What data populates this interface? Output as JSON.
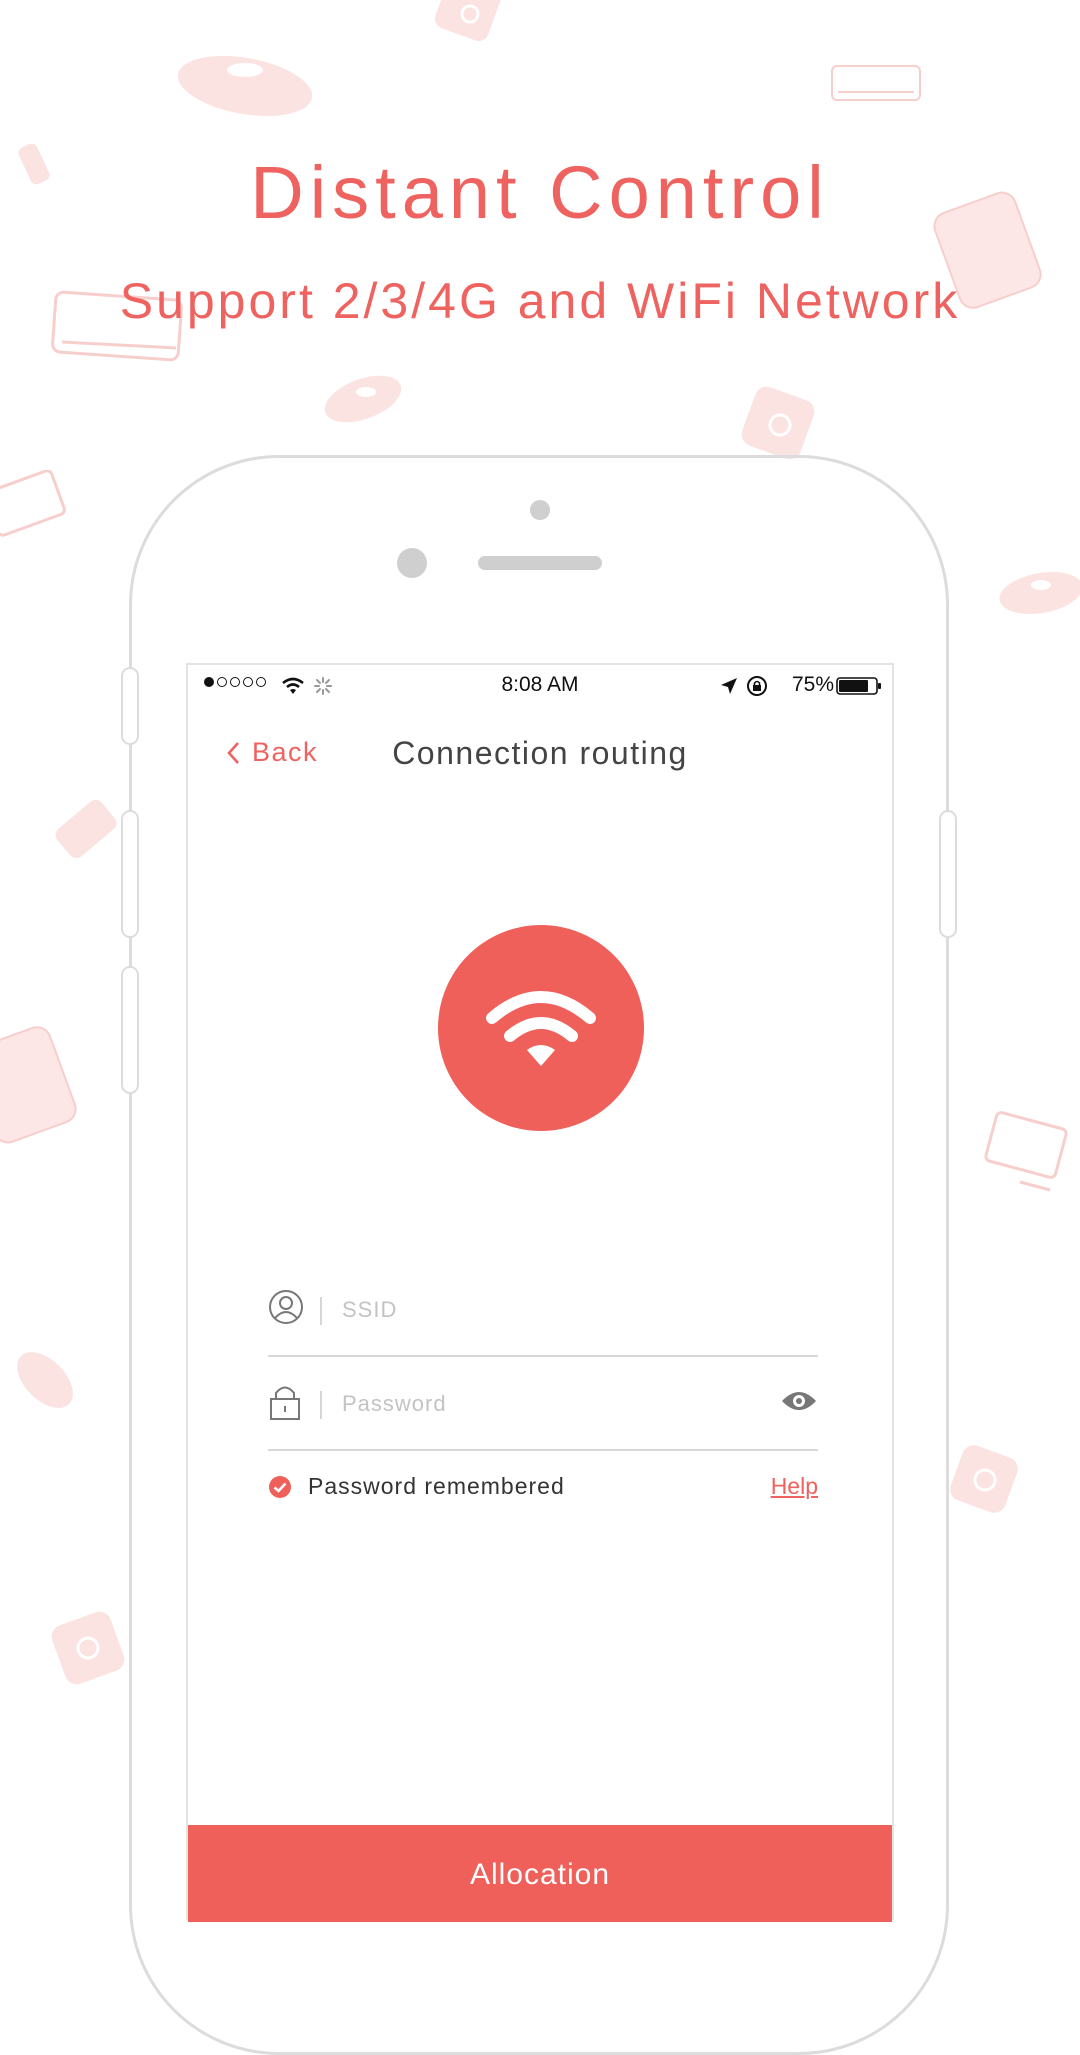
{
  "promo": {
    "headline": "Distant  Control",
    "subline": "Support 2/3/4G and WiFi Network"
  },
  "status_bar": {
    "time": "8:08 AM",
    "battery": "75%",
    "icons": [
      "signal-dots-icon",
      "wifi-icon",
      "activity-spinner-icon",
      "location-arrow-icon",
      "rotation-lock-icon",
      "battery-icon"
    ]
  },
  "nav": {
    "back_label": "Back",
    "title": "Connection routing"
  },
  "form": {
    "ssid": {
      "placeholder": "SSID",
      "value": ""
    },
    "password": {
      "placeholder": "Password",
      "value": ""
    },
    "remember_label": "Password remembered",
    "remember_checked": true,
    "help_label": "Help"
  },
  "action": {
    "label": "Allocation"
  },
  "colors": {
    "accent": "#f0605b",
    "text": "#444444",
    "divider": "#d8d8d8"
  }
}
